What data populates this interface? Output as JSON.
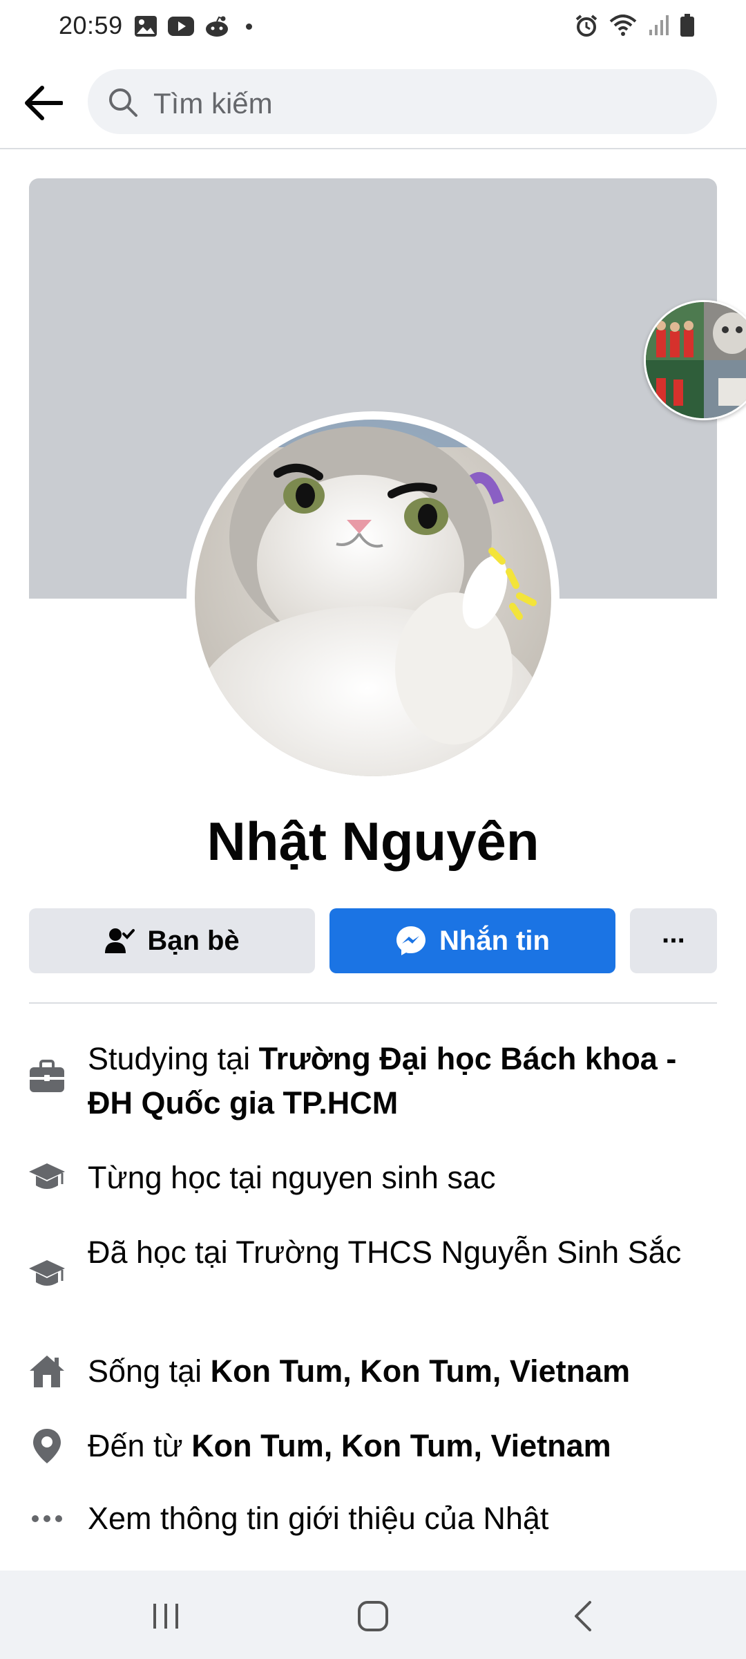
{
  "status_bar": {
    "time": "20:59",
    "left_icons": [
      "gallery-icon",
      "youtube-icon",
      "reddit-icon",
      "notification-dot-icon"
    ],
    "right_icons": [
      "alarm-icon",
      "wifi-icon",
      "signal-icon",
      "battery-icon"
    ]
  },
  "header": {
    "back_icon": "arrow-left-icon",
    "search_placeholder": "Tìm kiếm"
  },
  "profile": {
    "name": "Nhật Nguyên",
    "cover_color": "#c9ccd1"
  },
  "actions": {
    "friends_label": "Bạn bè",
    "message_label": "Nhắn tin",
    "more_label": "···",
    "accent": "#1b74e4"
  },
  "info": [
    {
      "icon": "briefcase-icon",
      "prefix": "Studying tại ",
      "bold": "Trường Đại học Bách khoa - ĐH Quốc gia TP.HCM"
    },
    {
      "icon": "graduation-cap-icon",
      "prefix": "Từng học tại nguyen sinh sac",
      "bold": ""
    },
    {
      "icon": "graduation-cap-icon",
      "prefix": "Đã học tại Trường THCS Nguyễn Sinh Sắc",
      "bold": ""
    },
    {
      "icon": "home-icon",
      "prefix": "Sống tại ",
      "bold": "Kon Tum, Kon Tum, Vietnam"
    },
    {
      "icon": "location-pin-icon",
      "prefix": "Đến từ ",
      "bold": "Kon Tum, Kon Tum, Vietnam"
    },
    {
      "icon": "more-dots-icon",
      "prefix": "Xem thông tin giới thiệu của Nhật",
      "bold": ""
    }
  ],
  "nav": {
    "recents_icon": "recents-icon",
    "home_icon": "home-button-icon",
    "back_icon": "back-chevron-icon"
  }
}
